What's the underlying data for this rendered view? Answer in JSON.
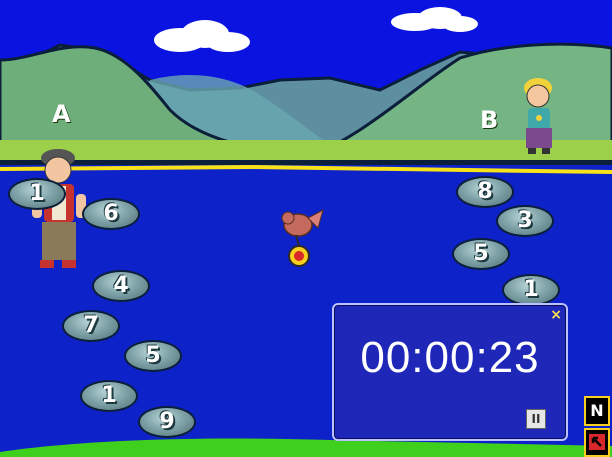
{
  "banks": {
    "left_label": "A",
    "right_label": "B"
  },
  "stones_left": [
    "1",
    "6",
    "4",
    "7",
    "5",
    "1",
    "9"
  ],
  "stones_right": [
    "8",
    "3",
    "5",
    "1"
  ],
  "timer": {
    "display": "00:00:23",
    "close_glyph": "×",
    "pause_glyph": "II"
  },
  "controls": {
    "next_label": "N",
    "exit_icon": "exit-arrow-icon"
  },
  "colors": {
    "sky": "#0a13e0",
    "river": "#0d22c8",
    "bank_line": "#f7e21a",
    "timer_bg": "#1f27b8",
    "accent": "#f7d01e"
  }
}
